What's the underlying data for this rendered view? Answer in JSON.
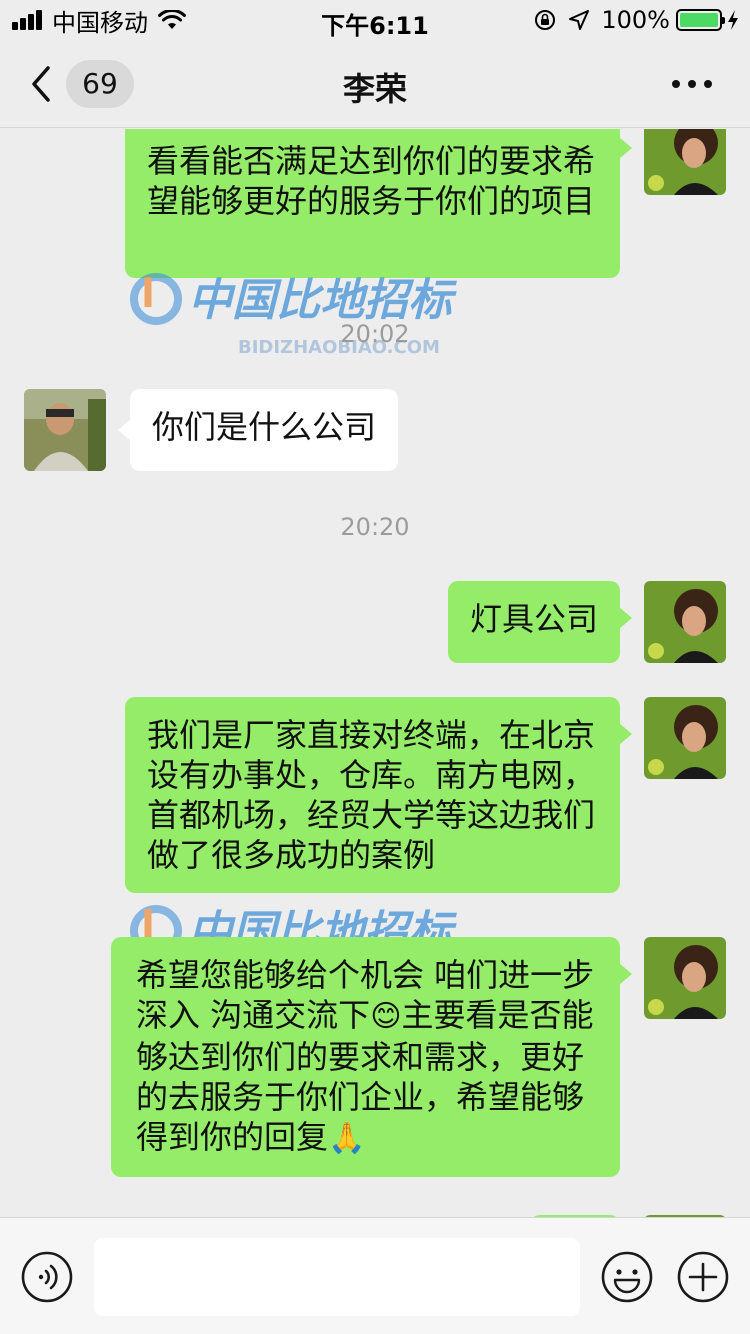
{
  "status_bar": {
    "carrier": "中国移动",
    "time": "下午6:11",
    "battery": "100%"
  },
  "nav": {
    "back_icon": "chevron-left-icon",
    "unread_count": "69",
    "title": "李荣",
    "more_icon": "more-dots-icon"
  },
  "watermark": {
    "cn": "中国比地招标",
    "en": "BIDIZHAOBIAO.COM"
  },
  "messages": [
    {
      "side": "out",
      "text": "看看能否满足达到你们的要求希望能够更好的服务于你们的项目"
    },
    {
      "type": "time",
      "text": "20:02"
    },
    {
      "side": "in",
      "text": "你们是什么公司"
    },
    {
      "type": "time",
      "text": "20:20"
    },
    {
      "side": "out",
      "text": "灯具公司"
    },
    {
      "side": "out",
      "text": "我们是厂家直接对终端，在北京设有办事处，仓库。南方电网，首都机场，经贸大学等这边我们做了很多成功的案例"
    },
    {
      "side": "out",
      "text_part1": "希望您能够给个机会 咱们进一步深入 沟通交流下",
      "emoji1": "😊",
      "text_part2": "主要看是否能够达到你们的要求和需求，更好的去服务于你们企业，希望能够得到你的回复",
      "emoji2": "🙏"
    }
  ],
  "colors": {
    "outgoing_bubble": "#95ec69",
    "incoming_bubble": "#ffffff",
    "background": "#ededed"
  },
  "input_bar": {
    "voice_icon": "voice-icon",
    "emoji_icon": "emoji-icon",
    "plus_icon": "plus-icon",
    "placeholder": ""
  }
}
